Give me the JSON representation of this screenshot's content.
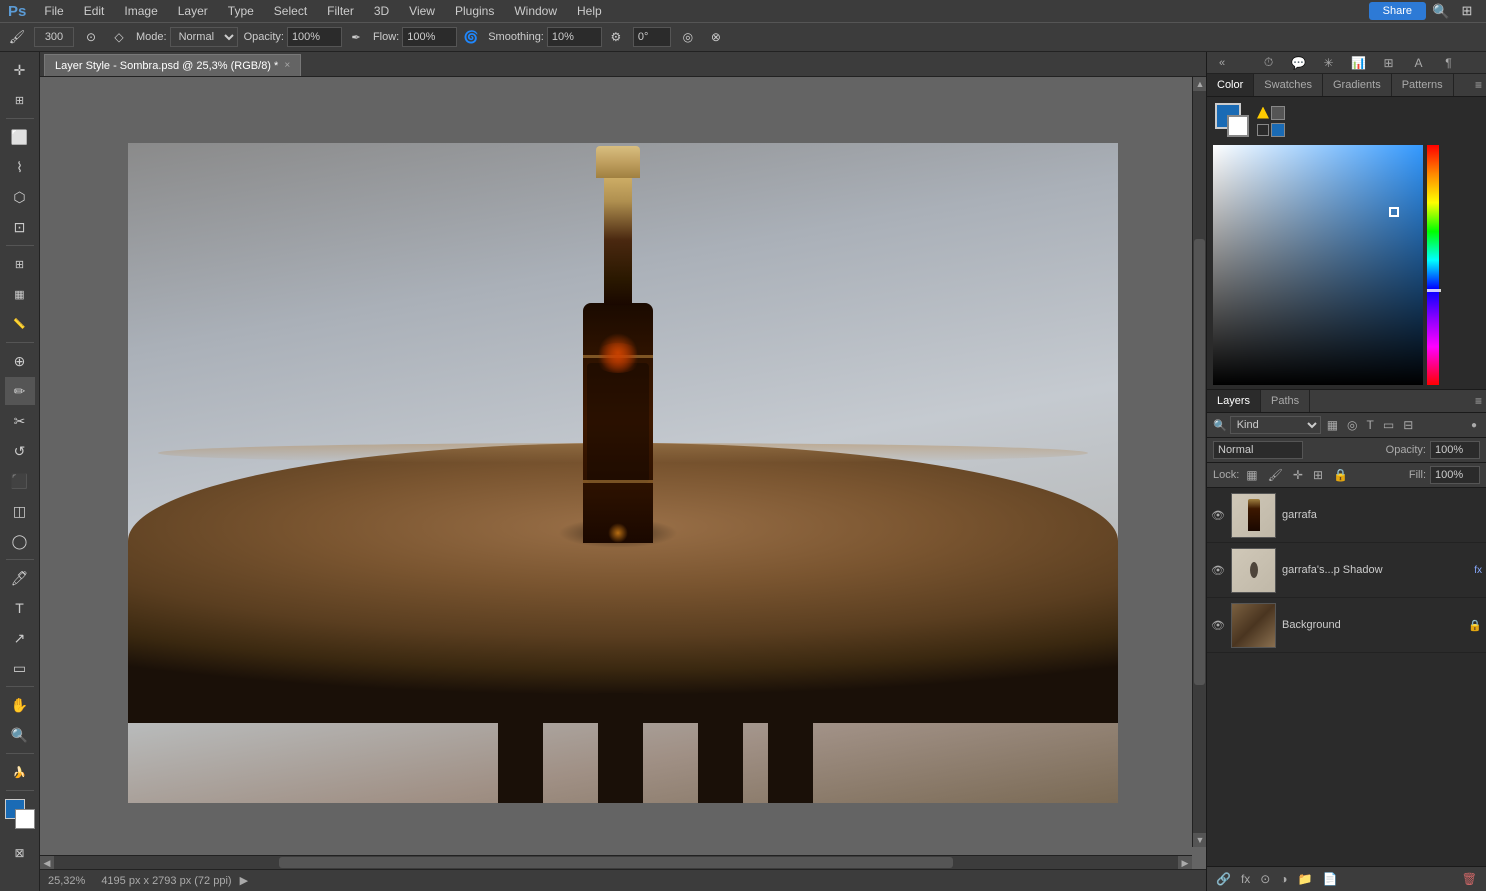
{
  "app": {
    "title": "Photoshop",
    "ps_logo": "Ps"
  },
  "menu": {
    "items": [
      "Ps",
      "File",
      "Edit",
      "Image",
      "Layer",
      "Type",
      "Select",
      "Filter",
      "3D",
      "View",
      "Plugins",
      "Window",
      "Help"
    ]
  },
  "options_bar": {
    "brush_size": "300",
    "mode_label": "Mode:",
    "mode_value": "Normal",
    "opacity_label": "Opacity:",
    "opacity_value": "100%",
    "flow_label": "Flow:",
    "flow_value": "100%",
    "smoothing_label": "Smoothing:",
    "smoothing_value": "10%",
    "angle_value": "0°"
  },
  "tab": {
    "title": "Layer Style - Sombra.psd @ 25,3% (RGB/8) *",
    "close": "×"
  },
  "color_panel": {
    "tabs": [
      "Color",
      "Swatches",
      "Gradients",
      "Patterns"
    ],
    "active_tab": "Color"
  },
  "right_panel": {
    "collapse_left": "«",
    "collapse_right": "»",
    "menu_icon": "≡"
  },
  "layers_panel": {
    "tabs": [
      "Layers",
      "Paths"
    ],
    "active_tab": "Layers",
    "search_placeholder": "Kind",
    "mode_value": "Normal",
    "opacity_label": "Opacity:",
    "opacity_value": "100%",
    "fill_label": "Fill:",
    "fill_value": "100%",
    "lock_label": "Lock:",
    "layers": [
      {
        "name": "garrafa",
        "visible": true,
        "active": false,
        "type": "image"
      },
      {
        "name": "garrafa's...p Shadow",
        "visible": true,
        "active": false,
        "type": "fx",
        "has_fx": true
      },
      {
        "name": "Background",
        "visible": true,
        "active": false,
        "type": "background",
        "locked": true
      }
    ]
  },
  "status_bar": {
    "zoom": "25,32%",
    "dimensions": "4195 px x 2793 px (72 ppi)",
    "arrow": ">"
  },
  "tools": [
    {
      "name": "move",
      "icon": "✛"
    },
    {
      "name": "rectangular-marquee",
      "icon": "⬜"
    },
    {
      "name": "lasso",
      "icon": "⌇"
    },
    {
      "name": "quick-select",
      "icon": "⬡"
    },
    {
      "name": "crop",
      "icon": "⊡"
    },
    {
      "name": "eyedropper",
      "icon": "✒"
    },
    {
      "name": "spot-healing",
      "icon": "⊕"
    },
    {
      "name": "brush",
      "icon": "✏"
    },
    {
      "name": "clone-stamp",
      "icon": "✂"
    },
    {
      "name": "history-brush",
      "icon": "↺"
    },
    {
      "name": "eraser",
      "icon": "⬛"
    },
    {
      "name": "gradient",
      "icon": "◫"
    },
    {
      "name": "dodge",
      "icon": "◯"
    },
    {
      "name": "pen",
      "icon": "✒"
    },
    {
      "name": "type",
      "icon": "T"
    },
    {
      "name": "path-selection",
      "icon": "↗"
    },
    {
      "name": "shape",
      "icon": "▭"
    },
    {
      "name": "hand",
      "icon": "✋"
    },
    {
      "name": "zoom",
      "icon": "🔍"
    },
    {
      "name": "extra",
      "icon": "🍌"
    }
  ],
  "share_button": {
    "label": "Share"
  }
}
